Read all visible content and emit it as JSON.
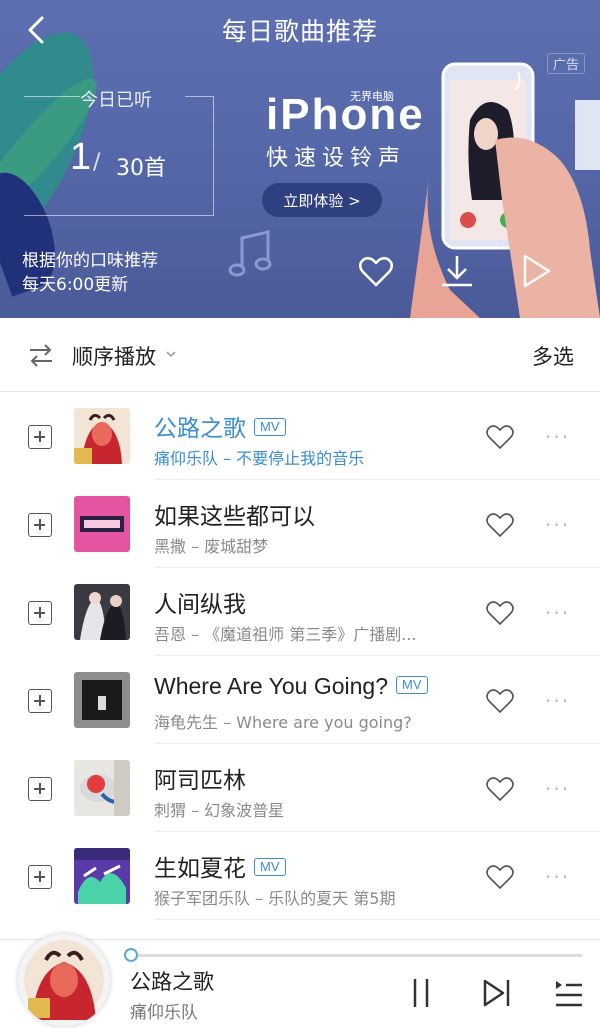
{
  "header": {
    "title": "每日歌曲推荐",
    "listen_label": "今日已听",
    "listen_count": "1",
    "listen_total": "30首",
    "desc_line1": "根据你的口味推荐",
    "desc_line2": "每天6:00更新",
    "ad_tag": "广告",
    "banner": {
      "brand": "iPhone",
      "brand_small": "无界电脑",
      "subtitle": "快速设铃声",
      "cta": "立即体验 >"
    },
    "icons": [
      "back-icon",
      "heart-icon",
      "download-icon",
      "play-icon"
    ],
    "colors": {
      "bg": "#5466a8",
      "cta_bg": "#2f4080"
    }
  },
  "toolbar": {
    "play_mode": "顺序播放",
    "multi_select": "多选"
  },
  "songs": [
    {
      "title": "公路之歌",
      "subtitle": "痛仰乐队 – 不要停止我的音乐",
      "mv": "MV",
      "active": true
    },
    {
      "title": "如果这些都可以",
      "subtitle": "黑撒 – 废城甜梦",
      "mv": "",
      "active": false
    },
    {
      "title": "人间纵我",
      "subtitle": "吾恩 – 《魔道祖师 第三季》广播剧...",
      "mv": "",
      "active": false
    },
    {
      "title": "Where Are You Going?",
      "subtitle": "海龟先生 – Where are you going?",
      "mv": "MV",
      "active": false
    },
    {
      "title": "阿司匹林",
      "subtitle": "刺猬 – 幻象波普星",
      "mv": "",
      "active": false
    },
    {
      "title": "生如夏花",
      "subtitle": "猴子军团乐队 – 乐队的夏天 第5期",
      "mv": "MV",
      "active": false
    }
  ],
  "player": {
    "title": "公路之歌",
    "artist": "痛仰乐队",
    "progress": 0.0,
    "icons": [
      "pause-icon",
      "next-icon",
      "playlist-icon"
    ]
  },
  "accent_color": "#3a8ed3"
}
